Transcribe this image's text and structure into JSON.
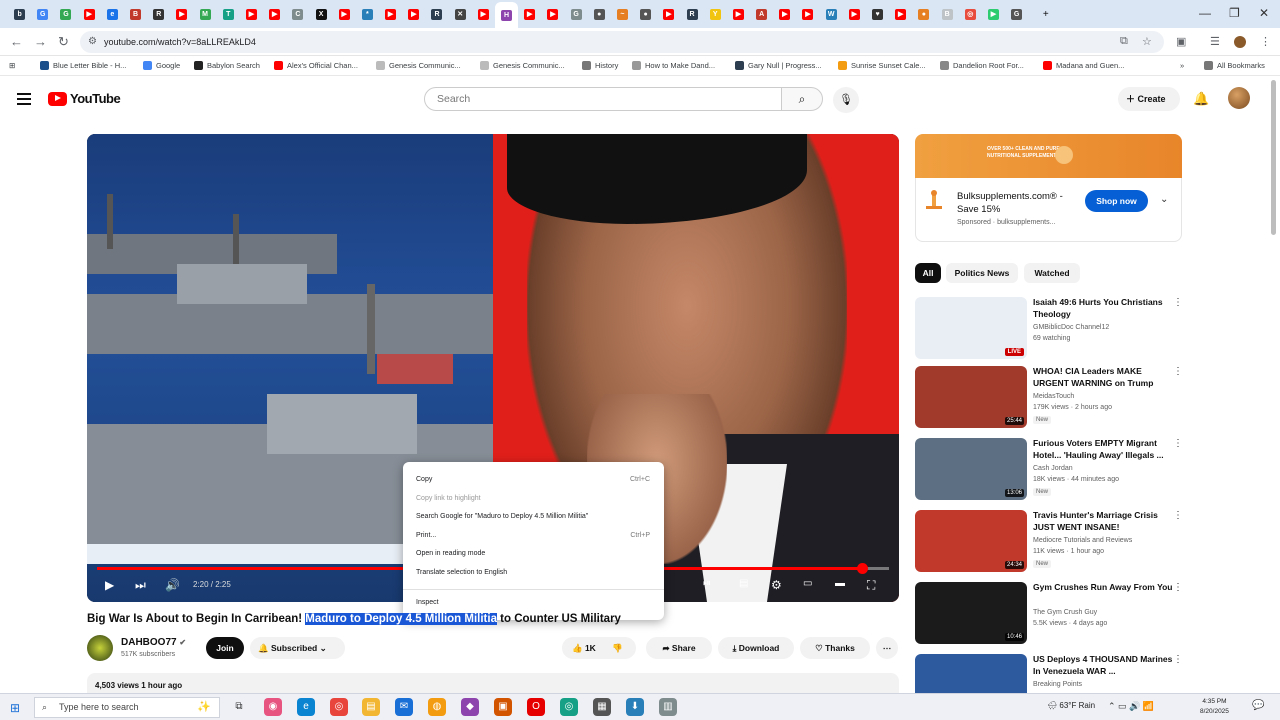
{
  "browser": {
    "tabs": [
      {
        "letter": "b",
        "color": "#2c3e50"
      },
      {
        "letter": "G",
        "color": "#4285f4"
      },
      {
        "letter": "G",
        "color": "#34a853"
      },
      {
        "letter": "▶",
        "color": "#ff0000"
      },
      {
        "letter": "e",
        "color": "#1a73e8"
      },
      {
        "letter": "B",
        "color": "#c0392b"
      },
      {
        "letter": "R",
        "color": "#333333"
      },
      {
        "letter": "▶",
        "color": "#ff0000"
      },
      {
        "letter": "M",
        "color": "#34a853"
      },
      {
        "letter": "T",
        "color": "#16a085"
      },
      {
        "letter": "▶",
        "color": "#ff0000"
      },
      {
        "letter": "▶",
        "color": "#ff0000"
      },
      {
        "letter": "C",
        "color": "#7f8c8d"
      },
      {
        "letter": "X",
        "color": "#111111"
      },
      {
        "letter": "▶",
        "color": "#ff0000"
      },
      {
        "letter": "*",
        "color": "#2980b9"
      },
      {
        "letter": "▶",
        "color": "#ff0000"
      },
      {
        "letter": "▶",
        "color": "#ff0000"
      },
      {
        "letter": "R",
        "color": "#2c3e50"
      },
      {
        "letter": "✕",
        "color": "#444444"
      },
      {
        "letter": "▶",
        "color": "#ff0000"
      },
      {
        "letter": "H",
        "color": "#8e44ad"
      },
      {
        "letter": "▶",
        "color": "#ff0000"
      },
      {
        "letter": "▶",
        "color": "#ff0000"
      },
      {
        "letter": "G",
        "color": "#7f8c8d"
      },
      {
        "letter": "●",
        "color": "#555555"
      },
      {
        "letter": "~",
        "color": "#e67e22"
      },
      {
        "letter": "●",
        "color": "#555555"
      },
      {
        "letter": "▶",
        "color": "#ff0000"
      },
      {
        "letter": "R",
        "color": "#2c3e50"
      },
      {
        "letter": "Y",
        "color": "#f1c40f"
      },
      {
        "letter": "▶",
        "color": "#ff0000"
      },
      {
        "letter": "A",
        "color": "#c0392b"
      },
      {
        "letter": "▶",
        "color": "#ff0000"
      },
      {
        "letter": "▶",
        "color": "#ff0000"
      },
      {
        "letter": "W",
        "color": "#2980b9"
      },
      {
        "letter": "▶",
        "color": "#ff0000"
      },
      {
        "letter": "♥",
        "color": "#333333"
      },
      {
        "letter": "▶",
        "color": "#ff0000"
      },
      {
        "letter": "●",
        "color": "#e67e22"
      },
      {
        "letter": "B",
        "color": "#bdc3c7"
      },
      {
        "letter": "◎",
        "color": "#e74c3c"
      },
      {
        "letter": "▶",
        "color": "#2ecc71"
      },
      {
        "letter": "G",
        "color": "#555555"
      }
    ],
    "new_tab": "+",
    "url": "youtube.com/watch?v=8aLLREAkLD4",
    "bookmarks": [
      {
        "label": "Blue Letter Bible - H...",
        "color": "#1a4f8b"
      },
      {
        "label": "Google",
        "color": "#4285f4"
      },
      {
        "label": "Babylon Search",
        "color": "#222222"
      },
      {
        "label": "Alex's Official Chan...",
        "color": "#ff0000"
      },
      {
        "label": "Genesis Communic...",
        "color": "#bbbbbb"
      },
      {
        "label": "Genesis Communic...",
        "color": "#bbbbbb"
      },
      {
        "label": "History",
        "color": "#777777"
      },
      {
        "label": "How to Make Dand...",
        "color": "#999999"
      },
      {
        "label": "Gary Null | Progress...",
        "color": "#2c3e50"
      },
      {
        "label": "Sunrise Sunset Cale...",
        "color": "#f39c12"
      },
      {
        "label": "Dandelion Root For...",
        "color": "#888888"
      },
      {
        "label": "Madana and Guen...",
        "color": "#ff0000"
      }
    ],
    "all_bookmarks": "All Bookmarks"
  },
  "header": {
    "logo_text": "YouTube",
    "search_placeholder": "Search",
    "create_label": "Create"
  },
  "player": {
    "time": "2:20 / 2:25",
    "progress_fraction": 0.966
  },
  "context_menu": {
    "items": [
      {
        "label": "Copy",
        "shortcut": "Ctrl+C",
        "disabled": false
      },
      {
        "label": "Copy link to highlight",
        "shortcut": "",
        "disabled": true
      },
      {
        "label": "Search Google for \"Maduro to Deploy 4.5 Million Militia\"",
        "shortcut": "",
        "disabled": false
      },
      {
        "label": "Print...",
        "shortcut": "Ctrl+P",
        "disabled": false
      },
      {
        "label": "Open in reading mode",
        "shortcut": "",
        "disabled": false
      },
      {
        "label": "Translate selection to English",
        "shortcut": "",
        "disabled": false
      },
      {
        "label": "Inspect",
        "shortcut": "",
        "disabled": false
      }
    ]
  },
  "video": {
    "title_before": "Big War Is About to Begin In Carribean! ",
    "title_selected": "Maduro to Deploy 4.5 Million Militia",
    "title_after": " to Counter US Military",
    "channel": "DAHBOO77",
    "subscribers": "517K subscribers",
    "join_label": "Join",
    "subscribed_label": "Subscribed",
    "likes": "1K",
    "share_label": "Share",
    "download_label": "Download",
    "thanks_label": "Thanks",
    "views_line": "4,503 views  1 hour ago"
  },
  "ad": {
    "banner_text": "OVER 500+ CLEAN AND PURE NUTRITIONAL SUPPLEMENTS",
    "title": "Bulksupplements.com® - Save 15%",
    "sponsored": "Sponsored · bulksupplements...",
    "cta": "Shop now"
  },
  "chips": [
    "All",
    "Politics News",
    "Watched"
  ],
  "recommendations": [
    {
      "title": "Isaiah 49:6 Hurts You Christians Theology",
      "channel": "GMBiblicDoc Channel12",
      "meta": "69 watching",
      "badge": "",
      "duration": "",
      "live": "LIVE",
      "thumb": "#e9eef5"
    },
    {
      "title": "WHOA! CIA Leaders MAKE URGENT WARNING on Trump",
      "channel": "MeidasTouch",
      "meta": "179K views · 2 hours ago",
      "badge": "New",
      "duration": "25:44",
      "live": "",
      "thumb": "#a23a2c"
    },
    {
      "title": "Furious Voters EMPTY Migrant Hotel... 'Hauling Away' Illegals ...",
      "channel": "Cash Jordan",
      "meta": "18K views · 44 minutes ago",
      "badge": "New",
      "duration": "13:06",
      "live": "",
      "thumb": "#5d6f82"
    },
    {
      "title": "Travis Hunter's Marriage Crisis JUST WENT INSANE!",
      "channel": "Mediocre Tutorials and Reviews",
      "meta": "11K views · 1 hour ago",
      "badge": "New",
      "duration": "24:34",
      "live": "",
      "thumb": "#c0392b"
    },
    {
      "title": "Gym Crushes Run Away From You",
      "channel": "The Gym Crush Guy",
      "meta": "5.5K views · 4 days ago",
      "badge": "",
      "duration": "10:46",
      "live": "",
      "thumb": "#1b1b1b"
    },
    {
      "title": "US Deploys 4 THOUSAND Marines In Venezuela WAR ...",
      "channel": "Breaking Points",
      "meta": "",
      "badge": "",
      "duration": "",
      "live": "",
      "thumb": "#2d5a9e"
    }
  ],
  "taskbar": {
    "search_placeholder": "Type here to search",
    "weather": "63°F  Rain",
    "time": "4:35 PM",
    "date": "8/20/2025"
  }
}
